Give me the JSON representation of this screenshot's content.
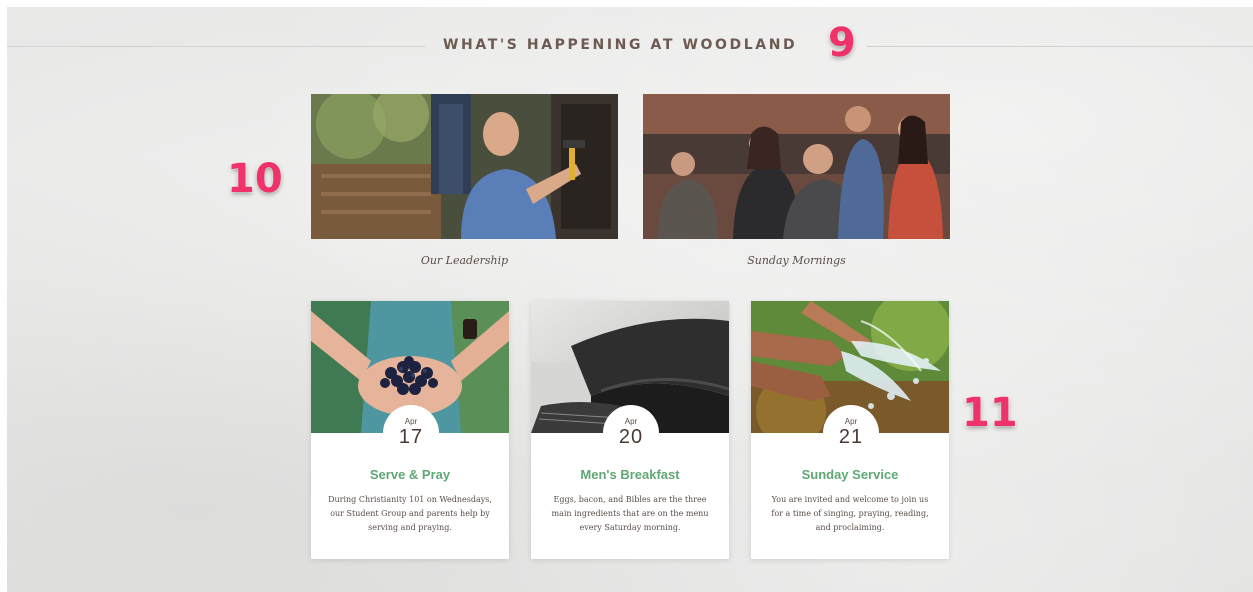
{
  "section": {
    "title": "WHAT'S HAPPENING AT WOODLAND"
  },
  "annotations": {
    "callout_1": "9",
    "callout_2": "10",
    "callout_3": "11"
  },
  "features": [
    {
      "caption": "Our Leadership",
      "image_icon": "volunteer-with-hammer-photo"
    },
    {
      "caption": "Sunday Mornings",
      "image_icon": "congregation-greeting-photo"
    }
  ],
  "events": [
    {
      "month": "Apr",
      "day": "17",
      "title": "Serve & Pray",
      "description": "During Christianity 101 on Wednesdays, our Student Group and parents help by serving and praying.",
      "image_icon": "hands-holding-blueberries-photo"
    },
    {
      "month": "Apr",
      "day": "20",
      "title": "Men's Breakfast",
      "description": "Eggs, bacon, and Bibles are the three main ingredients that are on the menu every Saturday morning.",
      "image_icon": "open-bible-photo"
    },
    {
      "month": "Apr",
      "day": "21",
      "title": "Sunday Service",
      "description": "You are invited and welcome to join us for a time of singing, praying, reading, and proclaiming.",
      "image_icon": "hands-in-water-splash-photo"
    }
  ],
  "colors": {
    "heading": "#6d5a52",
    "event_title": "#5fa774",
    "callout": "#f0326b"
  }
}
